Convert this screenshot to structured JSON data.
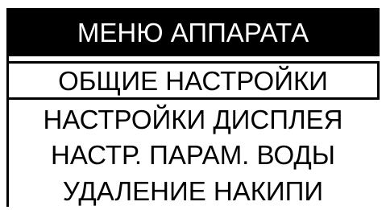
{
  "menu": {
    "title": "МЕНЮ АППАРАТА",
    "items": [
      {
        "label": "ОБЩИЕ НАСТРОЙКИ",
        "selected": true
      },
      {
        "label": "НАСТРОЙКИ ДИСПЛЕЯ",
        "selected": false
      },
      {
        "label": "НАСТР. ПАРАМ. ВОДЫ",
        "selected": false
      },
      {
        "label": "УДАЛЕНИЕ НАКИПИ",
        "selected": false
      }
    ]
  },
  "colors": {
    "background": "#ffffff",
    "foreground": "#000000",
    "title_text": "#ffffff"
  }
}
